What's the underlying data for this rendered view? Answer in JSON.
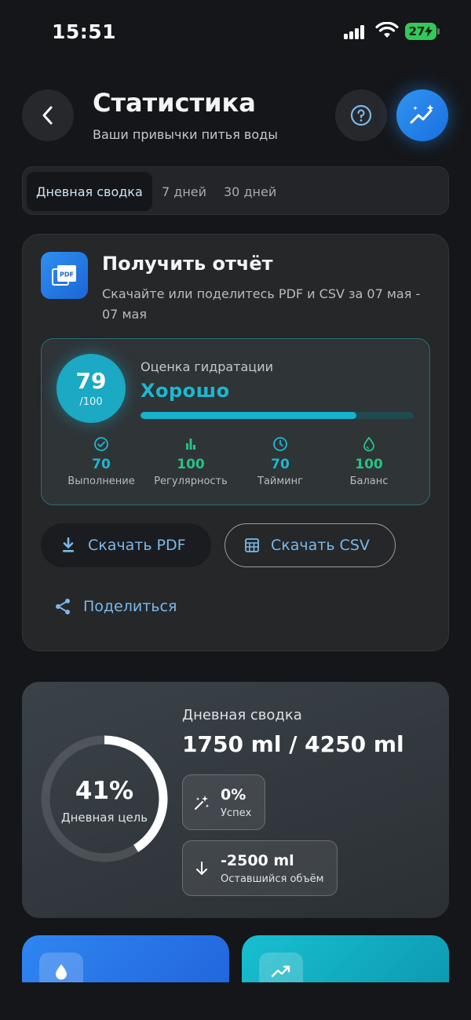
{
  "status_bar": {
    "time": "15:51",
    "battery": "27"
  },
  "header": {
    "title": "Статистика",
    "subtitle": "Ваши привычки питья воды"
  },
  "tabs": [
    {
      "label": "Дневная сводка",
      "active": true
    },
    {
      "label": "7 дней",
      "active": false
    },
    {
      "label": "30 дней",
      "active": false
    }
  ],
  "report": {
    "title": "Получить отчёт",
    "subtitle": "Скачайте или поделитесь PDF и CSV за 07 мая - 07 мая",
    "score": {
      "value": "79",
      "max": "/100",
      "label": "Оценка гидратации",
      "rating": "Хорошо",
      "progress": 0.79
    },
    "metrics": [
      {
        "value": "70",
        "name": "Выполнение",
        "icon": "check-circle-icon",
        "color": "#1fb6d1"
      },
      {
        "value": "100",
        "name": "Регулярность",
        "icon": "bar-chart-icon",
        "color": "#27c282"
      },
      {
        "value": "70",
        "name": "Тайминг",
        "icon": "clock-icon",
        "color": "#1fb6d1"
      },
      {
        "value": "100",
        "name": "Баланс",
        "icon": "drop-icon",
        "color": "#27c282"
      }
    ],
    "download_pdf": "Скачать PDF",
    "download_csv": "Скачать CSV",
    "share": "Поделиться"
  },
  "daily": {
    "percent": "41%",
    "percent_value": 0.41,
    "goal_label": "Дневная цель",
    "title": "Дневная сводка",
    "amount": "1750 ml / 4250 ml",
    "success_value": "0%",
    "success_label": "Успех",
    "remaining_value": "-2500 ml",
    "remaining_label": "Оставшийся объём"
  },
  "colors": {
    "accent": "#1fb6d1",
    "link": "#7cb8ea",
    "green": "#27c282",
    "brand_blue": "#2f86f2"
  }
}
